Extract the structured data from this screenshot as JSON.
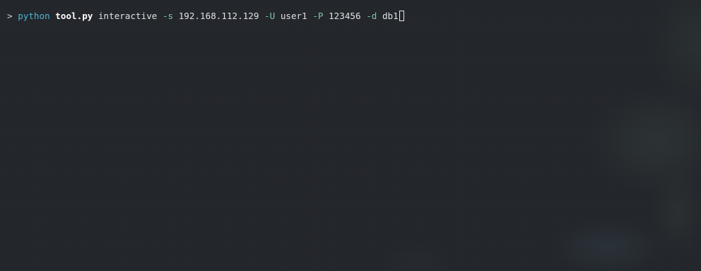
{
  "terminal": {
    "prompt": ">",
    "command": "python",
    "script": "tool.py",
    "subcommand": "interactive",
    "args": [
      {
        "flag": "-s",
        "value": "192.168.112.129"
      },
      {
        "flag": "-U",
        "value": "user1"
      },
      {
        "flag": "-P",
        "value": "123456"
      },
      {
        "flag": "-d",
        "value": "db1"
      }
    ],
    "colors": {
      "background": "#23262b",
      "command": "#4fb4d6",
      "flag": "#7fc4a8",
      "text": "#dfe1e3"
    }
  }
}
